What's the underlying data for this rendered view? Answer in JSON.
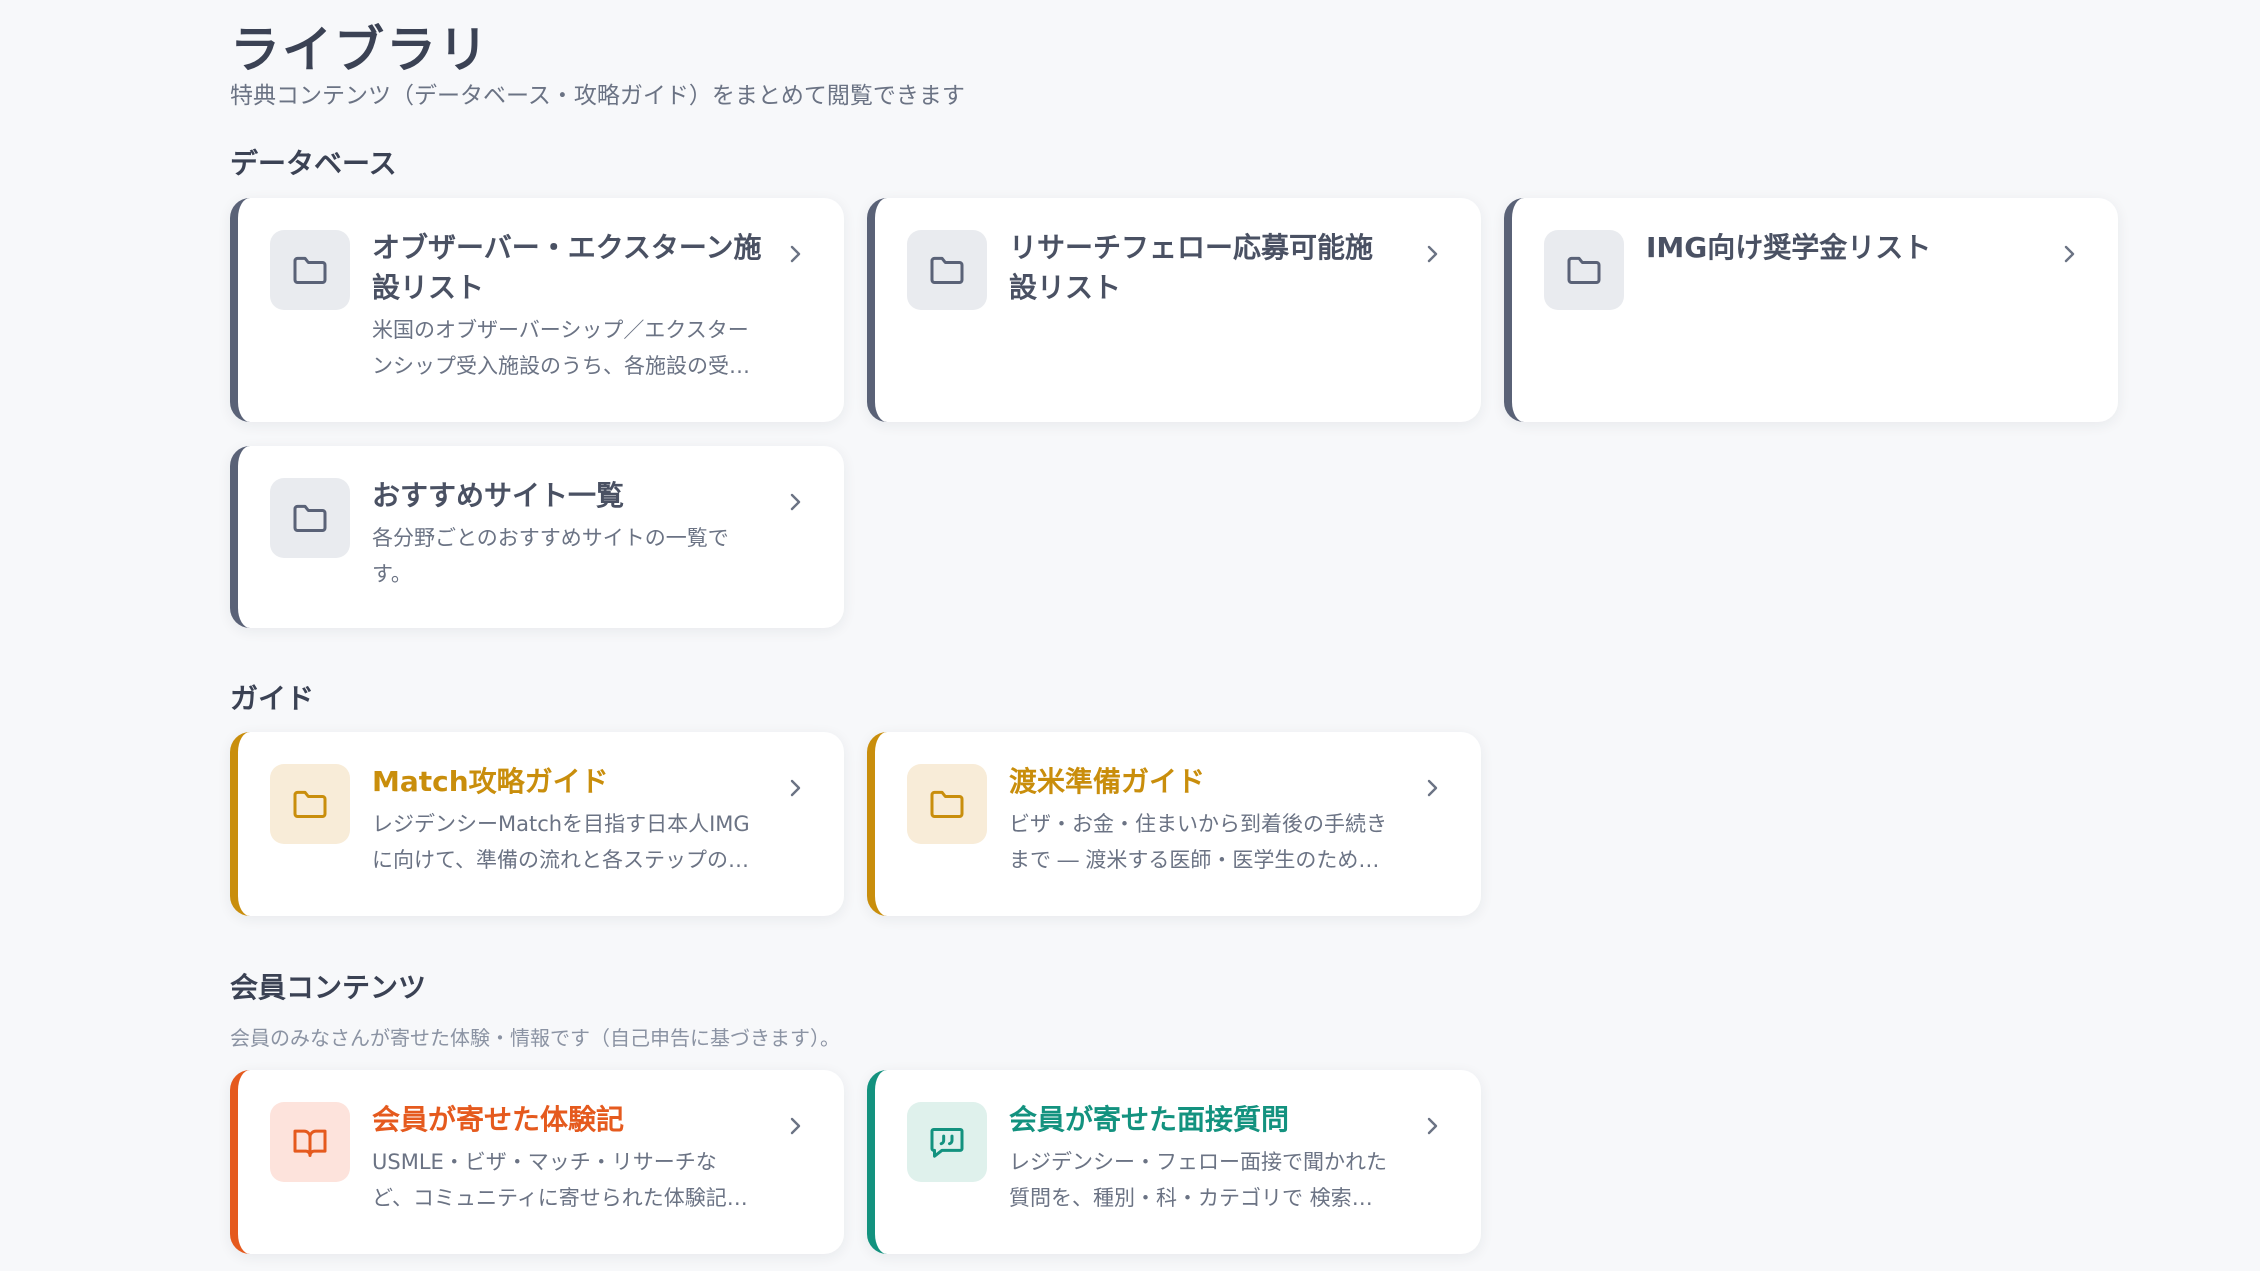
{
  "header": {
    "title": "ライブラリ",
    "subtitle": "特典コンテンツ（データベース・攻略ガイド）をまとめて閲覧できます"
  },
  "sections": {
    "database": {
      "title": "データベース",
      "cards": [
        {
          "title": "オブザーバー・エクスターン施設リスト",
          "desc": "米国のオブザーバーシップ／エクスターンシップ受入施設のうち、各施設の受入条件や応募方法をまとめたリストです。",
          "icon": "folder-icon"
        },
        {
          "title": "リサーチフェロー応募可能施設リスト",
          "desc": "",
          "icon": "folder-icon"
        },
        {
          "title": "IMG向け奨学金リスト",
          "desc": "",
          "icon": "folder-icon"
        },
        {
          "title": "おすすめサイト一覧",
          "desc": "各分野ごとのおすすめサイトの一覧です。",
          "icon": "folder-icon"
        }
      ]
    },
    "guide": {
      "title": "ガイド",
      "cards": [
        {
          "title": "Match攻略ガイド",
          "desc": "レジデンシーMatchを目指す日本人IMGに向けて、準備の流れと各ステップのポイントを解説します。",
          "icon": "folder-icon"
        },
        {
          "title": "渡米準備ガイド",
          "desc": "ビザ・お金・住まいから到着後の手続きまで ― 渡米する医師・医学生のための準備ガイドです。",
          "icon": "folder-icon"
        }
      ]
    },
    "member": {
      "title": "会員コンテンツ",
      "note": "会員のみなさんが寄せた体験・情報です（自己申告に基づきます）。",
      "cards": [
        {
          "title": "会員が寄せた体験記",
          "desc": "USMLE・ビザ・マッチ・リサーチなど、コミュニティに寄せられた体験記を読むことができます。",
          "icon": "book-icon"
        },
        {
          "title": "会員が寄せた面接質問",
          "desc": "レジデンシー・フェロー面接で聞かれた質問を、種別・科・カテゴリで 検索できます。",
          "icon": "chat-quote-icon"
        }
      ]
    }
  },
  "colors": {
    "database_accent": "#5a6277",
    "guide_accent": "#c98e0c",
    "experience_accent": "#e55a1e",
    "interview_accent": "#13927f"
  }
}
